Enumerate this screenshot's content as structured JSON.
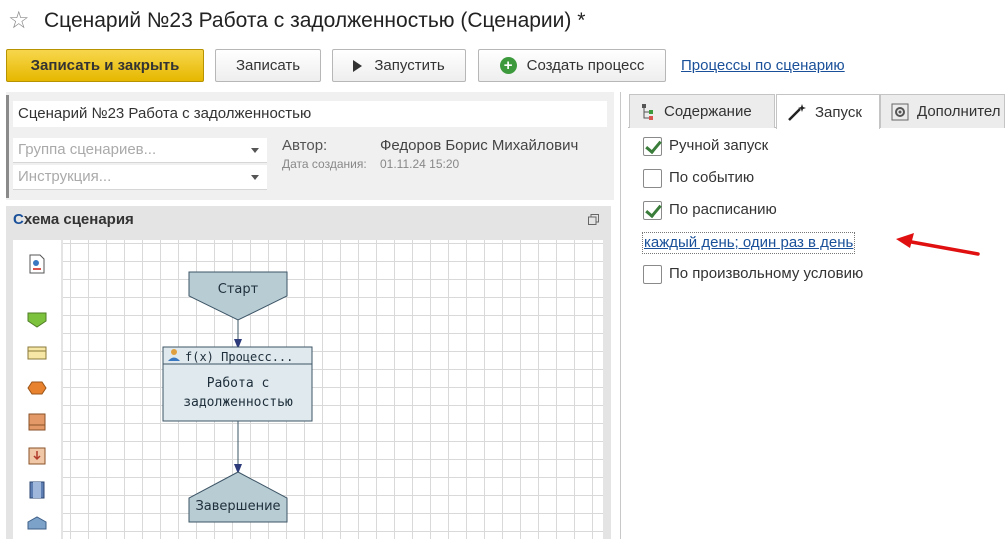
{
  "window": {
    "title": "Сценарий №23 Работа с задолженностью (Сценарии) *"
  },
  "toolbar": {
    "save_close_label": "Записать и закрыть",
    "save_label": "Записать",
    "run_label": "Запустить",
    "create_process_label": "Создать процесс",
    "processes_link": "Процессы по сценарию"
  },
  "form": {
    "name_value": "Сценарий №23 Работа с задолженностью",
    "group_placeholder": "Группа сценариев...",
    "instruction_placeholder": "Инструкция...",
    "author_label": "Автор:",
    "author_value": "Федоров Борис Михайлович",
    "date_label": "Дата создания:",
    "date_value": "01.11.24 15:20"
  },
  "schema": {
    "title_first": "С",
    "title_rest": "хема сценария",
    "start_label": "Старт",
    "process_header": "f(x)  Процесс...",
    "process_line1": "Работа с",
    "process_line2": "задолженностью",
    "end_label": "Завершение"
  },
  "tabs": [
    {
      "label": "Содержание",
      "icon": "tree-icon"
    },
    {
      "label": "Запуск",
      "icon": "magic-wand-icon"
    },
    {
      "label": "Дополнител",
      "icon": "settings-icon"
    }
  ],
  "launch": {
    "manual": {
      "label": "Ручной запуск",
      "checked": true
    },
    "event": {
      "label": "По событию",
      "checked": false
    },
    "schedule": {
      "label": "По расписанию",
      "checked": true
    },
    "schedule_link": "каждый день; один раз в день",
    "custom": {
      "label": "По произвольному условию",
      "checked": false
    }
  },
  "colors": {
    "primary_button": "#e6b800",
    "link": "#1a5099",
    "node_fill": "#b8ccd4",
    "process_fill": "#dfe9ee",
    "node_border": "#3d5566",
    "arrow_red": "#e01010"
  }
}
